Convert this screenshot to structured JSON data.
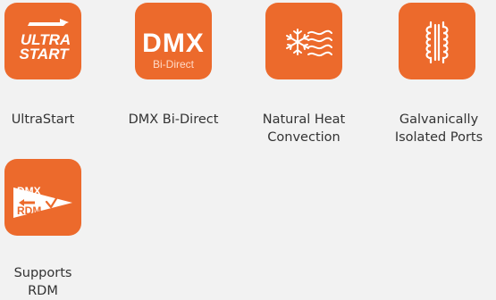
{
  "colors": {
    "background": "#f2f2f2",
    "tile_orange": "#ec6a2c",
    "icon_white": "#ffffff",
    "caption_text": "#333333"
  },
  "features": [
    {
      "icon": "ultrastart-logo-icon",
      "logo_line1": "ULTRA",
      "logo_line2": "START",
      "caption": "UltraStart"
    },
    {
      "icon": "dmx-bi-direct-logo-icon",
      "logo_line1": "DMX",
      "logo_line2": "Bi-Direct",
      "caption": "DMX Bi-Direct"
    },
    {
      "icon": "natural-heat-convection-icon",
      "caption": "Natural Heat\nConvection"
    },
    {
      "icon": "galvanic-isolation-transformer-icon",
      "caption": "Galvanically\nIsolated Ports"
    },
    {
      "icon": "supports-rdm-icon",
      "logo_line1": "DMX",
      "logo_line2": "RDM",
      "caption": "Supports RDM"
    }
  ]
}
